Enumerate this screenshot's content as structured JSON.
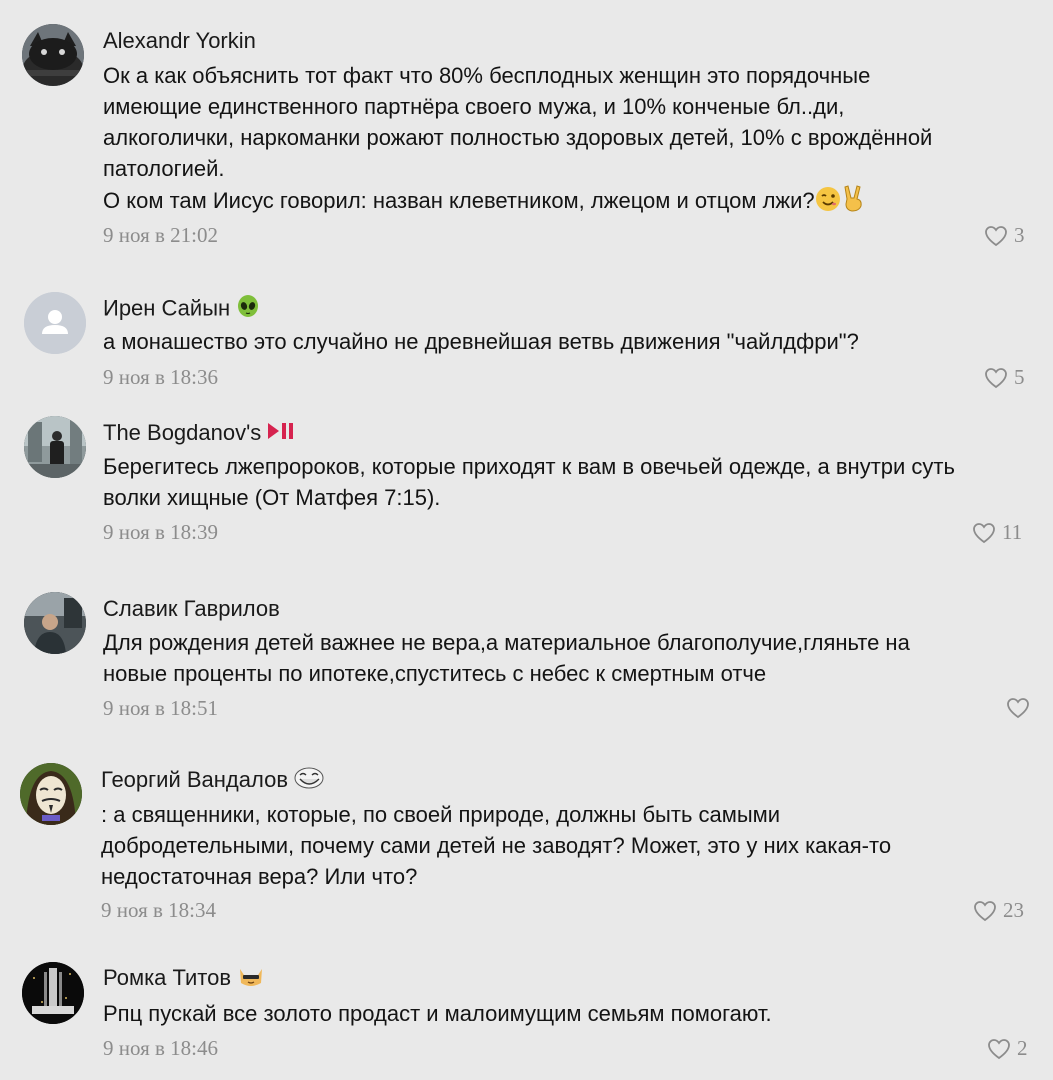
{
  "comments": [
    {
      "author": "Alexandr Yorkin",
      "lines": [
        "Ок а как объяснить тот факт что 80% бесплодных женщин это порядочные",
        "имеющие единственного партнёра своего мужа, и 10% конченые бл..ди,",
        "алкоголички, наркоманки рожают полностью здоровых детей, 10% с врождённой",
        "патологией.",
        "О ком там Иисус говорил: назван клеветником, лжецом и отцом лжи?"
      ],
      "trailing_emojis": [
        "winking-face-emoji",
        "victory-hand-emoji"
      ],
      "date": "9 ноя в 21:02",
      "likes": "3"
    },
    {
      "author": "Ирен Сайын",
      "author_emoji": "alien-face-emoji",
      "lines": [
        "а монашество это случайно не древнейшая ветвь движения \"чайлдфри\"?"
      ],
      "date": "9 ноя в 18:36",
      "likes": "5"
    },
    {
      "author": "The Bogdanov's",
      "author_emoji": "play-pause-emoji",
      "lines": [
        "Берегитесь лжепророков, которые приходят к вам в овечьей одежде, а внутри суть",
        "волки хищные (От Матфея 7:15)."
      ],
      "date": "9 ноя в 18:39",
      "likes": "11"
    },
    {
      "author": "Славик Гаврилов",
      "lines": [
        "Для рождения детей важнее не вера,а материальное благополучие,гляньте на",
        "новые проценты по ипотеке,спуститесь с небес к смертным отче"
      ],
      "date": "9 ноя в 18:51",
      "likes": ""
    },
    {
      "author": "Георгий Вандалов",
      "author_emoji": "troll-face-emoji",
      "lines": [
        ": а священники, которые, по своей природе, должны быть самыми",
        "добродетельными, почему сами детей не заводят? Может, это у них какая-то",
        "недостаточная вера? Или что?"
      ],
      "date": "9 ноя в 18:34",
      "likes": "23"
    },
    {
      "author": "Ромка Титов",
      "author_emoji": "cool-cat-emoji",
      "lines": [
        "Рпц пускай все золото продаст и малоимущим семьям помогают."
      ],
      "date": "9 ноя в 18:46",
      "likes": "2"
    }
  ],
  "colors": {
    "background": "#e9e9e9",
    "text": "#141414",
    "meta": "#8c8c8c",
    "default_avatar": "#c9ced6"
  }
}
